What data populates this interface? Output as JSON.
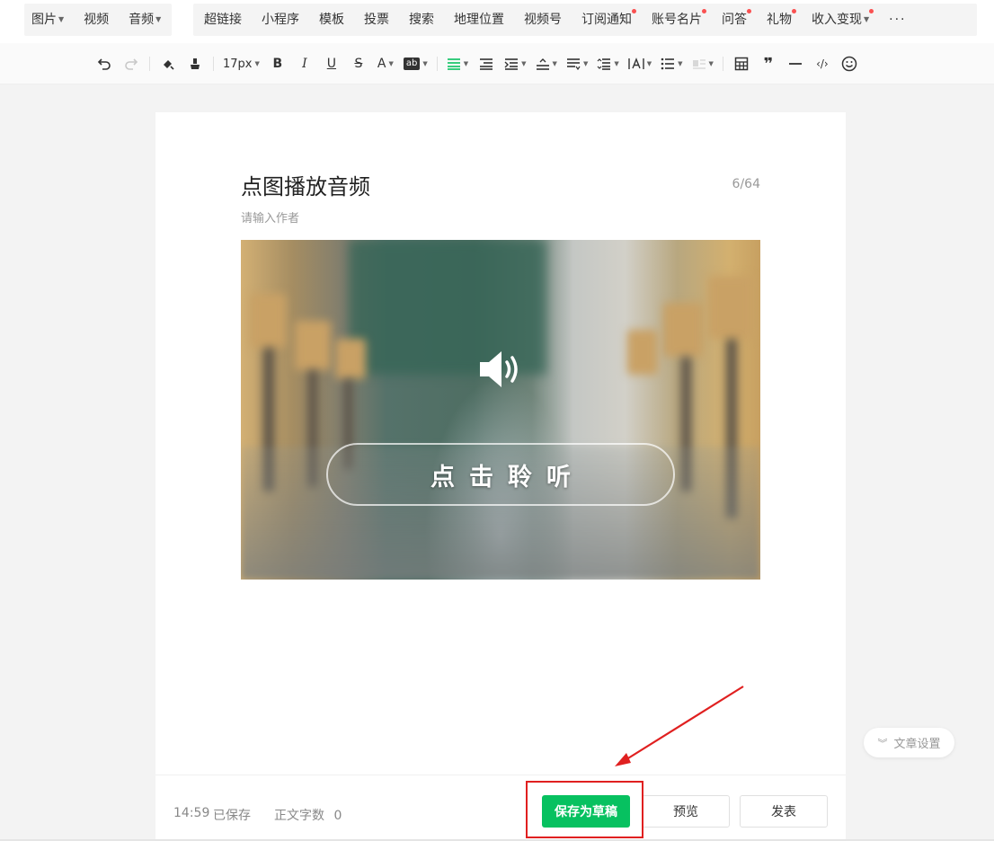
{
  "insert_bar": {
    "group1": [
      {
        "label": "图片",
        "caret": true
      },
      {
        "label": "视频",
        "caret": false
      },
      {
        "label": "音频",
        "caret": true
      }
    ],
    "group2": [
      {
        "label": "超链接",
        "dot": false
      },
      {
        "label": "小程序",
        "dot": false
      },
      {
        "label": "模板",
        "dot": false
      },
      {
        "label": "投票",
        "dot": false
      },
      {
        "label": "搜索",
        "dot": false
      },
      {
        "label": "地理位置",
        "dot": false
      },
      {
        "label": "视频号",
        "dot": false
      },
      {
        "label": "订阅通知",
        "dot": true
      },
      {
        "label": "账号名片",
        "dot": true
      },
      {
        "label": "问答",
        "dot": true
      },
      {
        "label": "礼物",
        "dot": true
      },
      {
        "label": "收入变现",
        "dot": true,
        "caret": true
      }
    ],
    "more_label": "···"
  },
  "format_bar": {
    "font_size": "17px",
    "bold": "B",
    "italic": "I",
    "underline": "U",
    "strike": "S",
    "font_color": "A",
    "bg_color_badge": "ab",
    "quote": "❞",
    "code": "‹/›"
  },
  "editor": {
    "title": "点图播放音频",
    "title_count": "6/64",
    "author_placeholder": "请输入作者",
    "cover_button_text": "点击聆听"
  },
  "status": {
    "time": "14:59",
    "saved": "已保存",
    "word_count_label": "正文字数",
    "word_count": "0"
  },
  "actions": {
    "save_draft": "保存为草稿",
    "preview": "预览",
    "publish": "发表"
  },
  "article_settings": "文章设置",
  "colors": {
    "primary": "#07c160",
    "annotation": "#e02020",
    "notify_dot": "#fa5151"
  }
}
